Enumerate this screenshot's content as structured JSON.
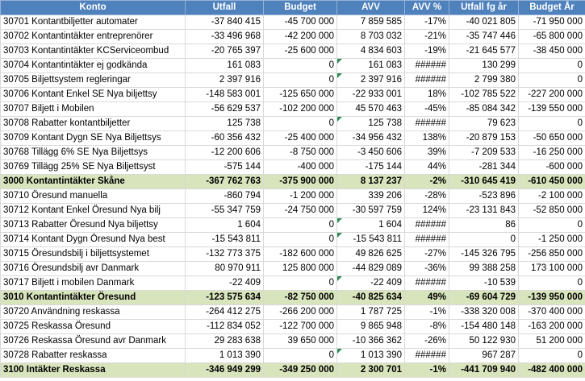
{
  "columns": [
    "Konto",
    "Utfall",
    "Budget",
    "AVV",
    "AVV %",
    "Utfall fg år",
    "Budget År"
  ],
  "rows": [
    {
      "cells": [
        "30701 Kontantbiljetter automater",
        "-37 840 415",
        "-45 700 000",
        "7 859 585",
        "-17%",
        "-40 021 805",
        "-71 950 000"
      ],
      "sum": false,
      "tri": false
    },
    {
      "cells": [
        "30702 Kontantintäkter entreprenörer",
        "-33 496 968",
        "-42 200 000",
        "8 703 032",
        "-21%",
        "-35 747 446",
        "-65 800 000"
      ],
      "sum": false,
      "tri": false
    },
    {
      "cells": [
        "30703 Kontantintäkter KCServiceombud",
        "-20 765 397",
        "-25 600 000",
        "4 834 603",
        "-19%",
        "-21 645 577",
        "-38 450 000"
      ],
      "sum": false,
      "tri": false
    },
    {
      "cells": [
        "30704 Kontantintäkter ej godkända",
        "161 083",
        "0",
        "161 083",
        "######",
        "130 299",
        "0"
      ],
      "sum": false,
      "tri": true
    },
    {
      "cells": [
        "30705 Biljettsystem regleringar",
        "2 397 916",
        "0",
        "2 397 916",
        "######",
        "2 799 380",
        "0"
      ],
      "sum": false,
      "tri": true
    },
    {
      "cells": [
        "30706 Kontant Enkel SE Nya biljettsy",
        "-148 583 001",
        "-125 650 000",
        "-22 933 001",
        "18%",
        "-102 785 522",
        "-227 200 000"
      ],
      "sum": false,
      "tri": false
    },
    {
      "cells": [
        "30707 Biljett i Mobilen",
        "-56 629 537",
        "-102 200 000",
        "45 570 463",
        "-45%",
        "-85 084 342",
        "-139 550 000"
      ],
      "sum": false,
      "tri": false
    },
    {
      "cells": [
        "30708 Rabatter kontantbiljetter",
        "125 738",
        "0",
        "125 738",
        "######",
        "79 623",
        "0"
      ],
      "sum": false,
      "tri": true
    },
    {
      "cells": [
        "30709 Kontant Dygn SE Nya Biljettsys",
        "-60 356 432",
        "-25 400 000",
        "-34 956 432",
        "138%",
        "-20 879 153",
        "-50 650 000"
      ],
      "sum": false,
      "tri": false
    },
    {
      "cells": [
        "30768 Tillägg 6% SE Nya Biljettsys",
        "-12 200 606",
        "-8 750 000",
        "-3 450 606",
        "39%",
        "-7 209 533",
        "-16 250 000"
      ],
      "sum": false,
      "tri": false
    },
    {
      "cells": [
        "30769 Tillägg 25% SE Nya Biljettsyst",
        "-575 144",
        "-400 000",
        "-175 144",
        "44%",
        "-281 344",
        "-600 000"
      ],
      "sum": false,
      "tri": false
    },
    {
      "cells": [
        "3000 Kontantintäkter Skåne",
        "-367 762 763",
        "-375 900 000",
        "8 137 237",
        "-2%",
        "-310 645 419",
        "-610 450 000"
      ],
      "sum": true,
      "tri": false
    },
    {
      "cells": [
        "30710 Öresund manuella",
        "-860 794",
        "-1 200 000",
        "339 206",
        "-28%",
        "-523 896",
        "-2 100 000"
      ],
      "sum": false,
      "tri": false
    },
    {
      "cells": [
        "30712 Kontant Enkel Öresund Nya bilj",
        "-55 347 759",
        "-24 750 000",
        "-30 597 759",
        "124%",
        "-23 131 843",
        "-52 850 000"
      ],
      "sum": false,
      "tri": false
    },
    {
      "cells": [
        "30713 Rabatter Öresund Nya biljettsy",
        "1 604",
        "0",
        "1 604",
        "######",
        "86",
        "0"
      ],
      "sum": false,
      "tri": true
    },
    {
      "cells": [
        "30714 Kontant Dygn Öresund Nya best",
        "-15 543 811",
        "0",
        "-15 543 811",
        "######",
        "0",
        "-1 250 000"
      ],
      "sum": false,
      "tri": true
    },
    {
      "cells": [
        "30715 Öresundsbilj i biljettsystemet",
        "-132 773 375",
        "-182 600 000",
        "49 826 625",
        "-27%",
        "-145 326 795",
        "-256 850 000"
      ],
      "sum": false,
      "tri": false
    },
    {
      "cells": [
        "30716 Öresundsbilj avr Danmark",
        "80 970 911",
        "125 800 000",
        "-44 829 089",
        "-36%",
        "99 388 258",
        "173 100 000"
      ],
      "sum": false,
      "tri": false
    },
    {
      "cells": [
        "30717 Biljett i mobilen Danmark",
        "-22 409",
        "0",
        "-22 409",
        "######",
        "-10 539",
        "0"
      ],
      "sum": false,
      "tri": true
    },
    {
      "cells": [
        "3010 Kontantintäkter Öresund",
        "-123 575 634",
        "-82 750 000",
        "-40 825 634",
        "49%",
        "-69 604 729",
        "-139 950 000"
      ],
      "sum": true,
      "tri": false
    },
    {
      "cells": [
        "30720 Användning reskassa",
        "-264 412 275",
        "-266 200 000",
        "1 787 725",
        "-1%",
        "-338 320 008",
        "-370 400 000"
      ],
      "sum": false,
      "tri": false
    },
    {
      "cells": [
        "30725 Reskassa Öresund",
        "-112 834 052",
        "-122 700 000",
        "9 865 948",
        "-8%",
        "-154 480 148",
        "-163 200 000"
      ],
      "sum": false,
      "tri": false
    },
    {
      "cells": [
        "30726 Reskassa Öresund avr Danmark",
        "29 283 638",
        "39 650 000",
        "-10 366 362",
        "-26%",
        "50 122 930",
        "51 200 000"
      ],
      "sum": false,
      "tri": false
    },
    {
      "cells": [
        "30728 Rabatter reskassa",
        "1 013 390",
        "0",
        "1 013 390",
        "######",
        "967 287",
        "0"
      ],
      "sum": false,
      "tri": true
    },
    {
      "cells": [
        "3100 Intäkter Reskassa",
        "-346 949 299",
        "-349 250 000",
        "2 300 701",
        "-1%",
        "-441 709 940",
        "-482 400 000"
      ],
      "sum": true,
      "tri": false
    }
  ],
  "colors": {
    "header": "#4f81bd",
    "summary_row": "#d8e4bc",
    "error_marker": "#2e8b57"
  }
}
